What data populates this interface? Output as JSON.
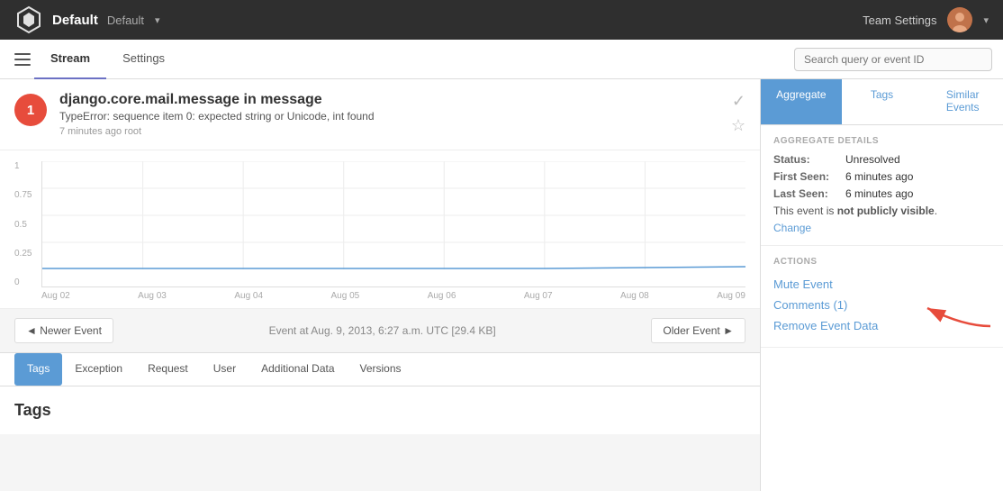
{
  "topNav": {
    "brand": "Default",
    "project": "Default",
    "dropdownIcon": "▾",
    "teamSettings": "Team Settings"
  },
  "subNav": {
    "tabs": [
      {
        "label": "Stream",
        "active": true
      },
      {
        "label": "Settings",
        "active": false
      }
    ],
    "searchPlaceholder": "Search query or event ID"
  },
  "event": {
    "count": "1",
    "title": "django.core.mail.message in message",
    "subtitle": "TypeError: sequence item 0: expected string or Unicode, int found",
    "meta": "7 minutes ago   root",
    "checkIcon": "✓",
    "starIcon": "★"
  },
  "chart": {
    "yLabels": [
      "1",
      "0.75",
      "0.5",
      "0.25",
      "0"
    ],
    "xLabels": [
      "Aug 02",
      "Aug 03",
      "Aug 04",
      "Aug 05",
      "Aug 06",
      "Aug 07",
      "Aug 08",
      "Aug 09"
    ]
  },
  "eventNav": {
    "newerBtn": "◄ Newer Event",
    "timestamp": "Event at Aug. 9, 2013, 6:27 a.m. UTC [29.4 KB]",
    "olderBtn": "Older Event ►"
  },
  "innerTabs": [
    {
      "label": "Tags",
      "active": true
    },
    {
      "label": "Exception",
      "active": false
    },
    {
      "label": "Request",
      "active": false
    },
    {
      "label": "User",
      "active": false
    },
    {
      "label": "Additional Data",
      "active": false
    },
    {
      "label": "Versions",
      "active": false
    }
  ],
  "pageSection": {
    "heading": "Tags"
  },
  "sidebar": {
    "tabs": [
      {
        "label": "Aggregate",
        "active": true
      },
      {
        "label": "Tags",
        "active": false
      },
      {
        "label": "Similar Events",
        "active": false
      }
    ],
    "aggregateDetails": {
      "sectionTitle": "AGGREGATE DETAILS",
      "status": {
        "label": "Status:",
        "value": "Unresolved"
      },
      "firstSeen": {
        "label": "First Seen:",
        "value": "6 minutes ago"
      },
      "lastSeen": {
        "label": "Last Seen:",
        "value": "6 minutes ago"
      },
      "visibilityNote": "This event is",
      "visibilityBold": "not publicly visible",
      "visibilityPeriod": ".",
      "changeLink": "Change"
    },
    "actions": {
      "sectionTitle": "ACTIONS",
      "muteEvent": "Mute Event",
      "comments": "Comments (1)",
      "removeEventData": "Remove Event Data"
    }
  }
}
